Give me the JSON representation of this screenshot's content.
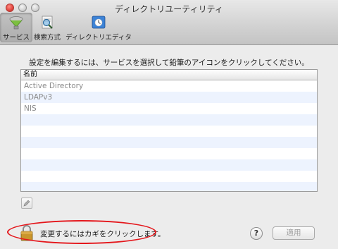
{
  "window": {
    "title": "ディレクトリユーティリティ"
  },
  "toolbar": {
    "items": [
      {
        "label": "サービス",
        "icon": "services-icon",
        "selected": true
      },
      {
        "label": "検索方式",
        "icon": "search-policy-icon",
        "selected": false
      },
      {
        "label": "ディレクトリエディタ",
        "icon": "directory-editor-icon",
        "selected": false
      }
    ]
  },
  "main": {
    "instruction": "設定を編集するには、サービスを選択して鉛筆のアイコンをクリックしてください。",
    "table": {
      "header": "名前",
      "rows": [
        "Active Directory",
        "LDAPv3",
        "NIS"
      ]
    },
    "edit_button_icon": "pencil-icon"
  },
  "footer": {
    "lock_label": "変更するにはカギをクリックします。",
    "lock_icon": "lock-icon",
    "help_label": "?",
    "apply_label": "適用"
  },
  "colors": {
    "annotation_oval": "#e4161b",
    "alt_row": "#edf3fe"
  }
}
